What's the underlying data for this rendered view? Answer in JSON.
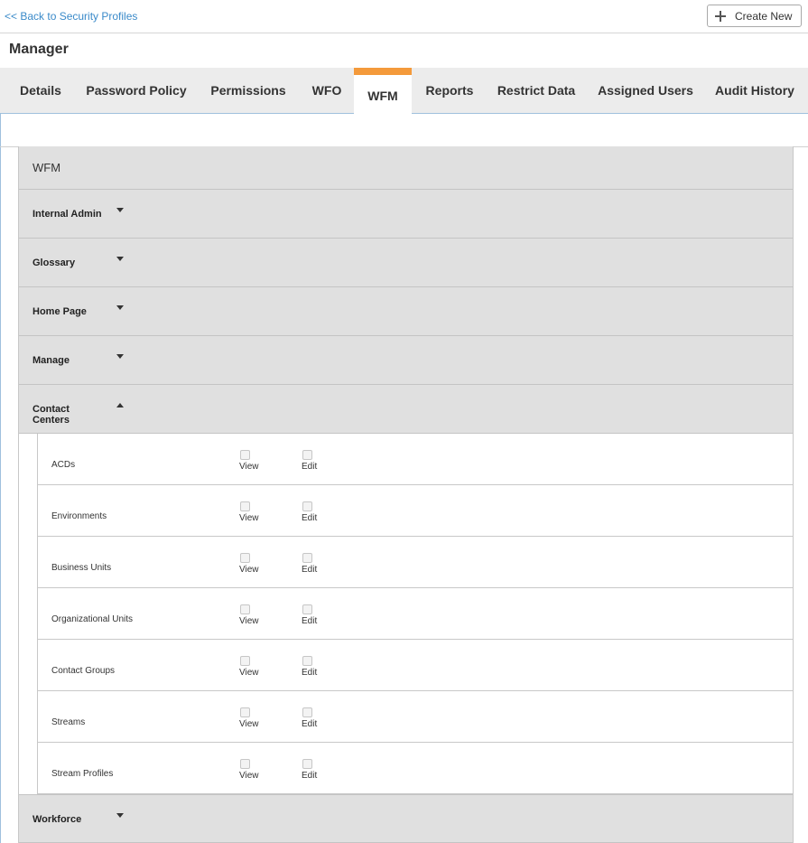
{
  "header": {
    "back_link": "<< Back to Security Profiles",
    "create_new": "Create New"
  },
  "page_title": "Manager",
  "tabs": [
    {
      "label": "Details"
    },
    {
      "label": "Password Policy"
    },
    {
      "label": "Permissions"
    },
    {
      "label": "WFO"
    },
    {
      "label": "WFM",
      "active": true
    },
    {
      "label": "Reports"
    },
    {
      "label": "Restrict Data"
    },
    {
      "label": "Assigned Users"
    },
    {
      "label": "Audit History"
    }
  ],
  "panel": {
    "heading": "WFM",
    "sections": [
      {
        "label": "Internal Admin",
        "expanded": false
      },
      {
        "label": "Glossary",
        "expanded": false
      },
      {
        "label": "Home Page",
        "expanded": false
      },
      {
        "label": "Manage",
        "expanded": false
      },
      {
        "label": "Contact Centers",
        "expanded": true
      }
    ],
    "perm_labels": {
      "view": "View",
      "edit": "Edit"
    },
    "contact_centers_items": [
      {
        "label": "ACDs",
        "view": false,
        "edit": false
      },
      {
        "label": "Environments",
        "view": false,
        "edit": false
      },
      {
        "label": "Business Units",
        "view": false,
        "edit": false
      },
      {
        "label": "Organizational Units",
        "view": false,
        "edit": false
      },
      {
        "label": "Contact Groups",
        "view": false,
        "edit": false
      },
      {
        "label": "Streams",
        "view": false,
        "edit": false
      },
      {
        "label": "Stream Profiles",
        "view": false,
        "edit": false
      }
    ],
    "after_section": {
      "label": "Workforce",
      "expanded": false
    }
  },
  "colors": {
    "link": "#3a8ac9",
    "active_tab_accent": "#f49a3b",
    "section_bg": "#e0e0e0"
  }
}
